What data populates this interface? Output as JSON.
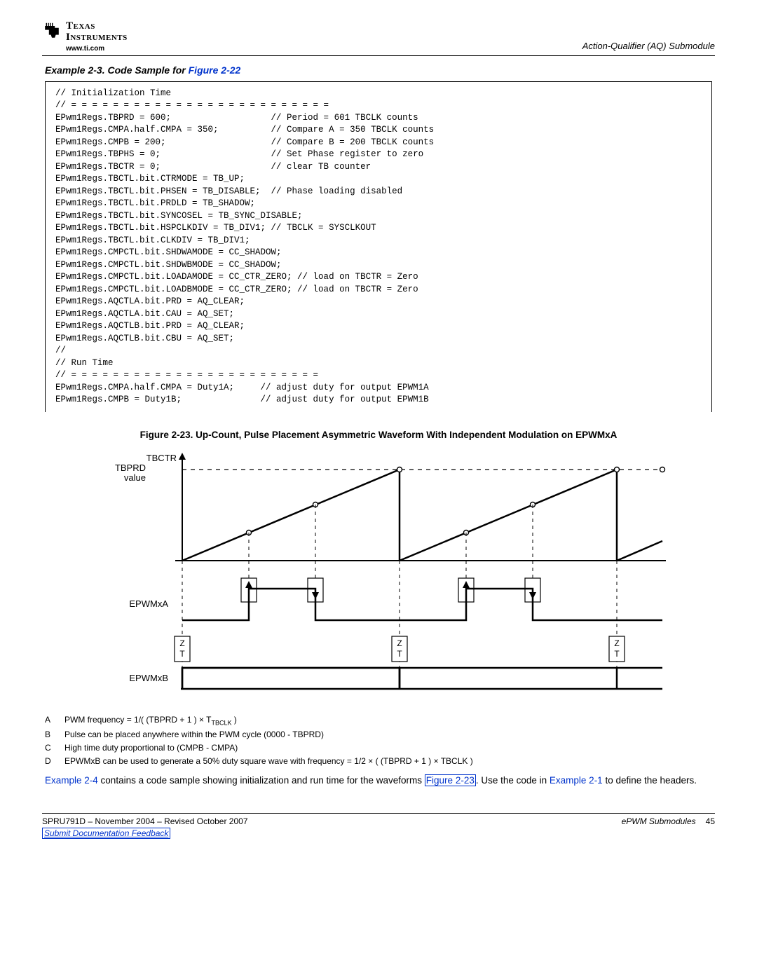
{
  "header": {
    "company_line1": "Texas",
    "company_line2": "Instruments",
    "url": "www.ti.com",
    "section": "Action-Qualifier (AQ) Submodule"
  },
  "example": {
    "title_prefix": "Example 2-3. Code Sample for ",
    "title_figref": "Figure 2-22",
    "code": "// Initialization Time\n// = = = = = = = = = = = = = = = = = = = = = = = = =\nEPwm1Regs.TBPRD = 600;                   // Period = 601 TBCLK counts\nEPwm1Regs.CMPA.half.CMPA = 350;          // Compare A = 350 TBCLK counts\nEPwm1Regs.CMPB = 200;                    // Compare B = 200 TBCLK counts\nEPwm1Regs.TBPHS = 0;                     // Set Phase register to zero\nEPwm1Regs.TBCTR = 0;                     // clear TB counter\nEPwm1Regs.TBCTL.bit.CTRMODE = TB_UP;\nEPwm1Regs.TBCTL.bit.PHSEN = TB_DISABLE;  // Phase loading disabled\nEPwm1Regs.TBCTL.bit.PRDLD = TB_SHADOW;\nEPwm1Regs.TBCTL.bit.SYNCOSEL = TB_SYNC_DISABLE;\nEPwm1Regs.TBCTL.bit.HSPCLKDIV = TB_DIV1; // TBCLK = SYSCLKOUT\nEPwm1Regs.TBCTL.bit.CLKDIV = TB_DIV1;\nEPwm1Regs.CMPCTL.bit.SHDWAMODE = CC_SHADOW;\nEPwm1Regs.CMPCTL.bit.SHDWBMODE = CC_SHADOW;\nEPwm1Regs.CMPCTL.bit.LOADAMODE = CC_CTR_ZERO; // load on TBCTR = Zero\nEPwm1Regs.CMPCTL.bit.LOADBMODE = CC_CTR_ZERO; // load on TBCTR = Zero\nEPwm1Regs.AQCTLA.bit.PRD = AQ_CLEAR;\nEPwm1Regs.AQCTLA.bit.CAU = AQ_SET;\nEPwm1Regs.AQCTLB.bit.PRD = AQ_CLEAR;\nEPwm1Regs.AQCTLB.bit.CBU = AQ_SET;\n//\n// Run Time\n// = = = = = = = = = = = = = = = = = = = = = = = =\nEPwm1Regs.CMPA.half.CMPA = Duty1A;     // adjust duty for output EPWM1A\nEPwm1Regs.CMPB = Duty1B;               // adjust duty for output EPWM1B"
  },
  "figure": {
    "caption": "Figure 2-23. Up-Count, Pulse Placement Asymmetric Waveform With Independent Modulation on EPWMxA",
    "labels": {
      "tbctr": "TBCTR",
      "tbprd": "TBPRD",
      "value": "value",
      "epwmxa": "EPWMxA",
      "epwmxb": "EPWMxB",
      "z": "Z",
      "t": "T"
    }
  },
  "notes": {
    "a_key": "A",
    "a_pre": "PWM frequency = 1/( (TBPRD + 1 ) × T",
    "a_sub": "TBCLK",
    "a_post": " )",
    "b_key": "B",
    "b": "Pulse can be placed anywhere within the PWM cycle (0000 - TBPRD)",
    "c_key": "C",
    "c": "High time duty proportional to (CMPB - CMPA)",
    "d_key": "D",
    "d": "EPWMxB can be used to generate a 50% duty square wave with frequency = 1/2 × ( (TBPRD + 1 ) × TBCLK )"
  },
  "para": {
    "p1a": "Example 2-4",
    "p1b": " contains a code sample showing initialization and run time for the waveforms ",
    "p1c": "Figure 2-23",
    "p1d": ". Use the code in ",
    "p1e": "Example 2-1",
    "p1f": " to define the headers."
  },
  "footer": {
    "docid": "SPRU791D – November 2004 – Revised October 2007",
    "feedback": "Submit Documentation Feedback",
    "section": "ePWM Submodules",
    "page": "45"
  }
}
